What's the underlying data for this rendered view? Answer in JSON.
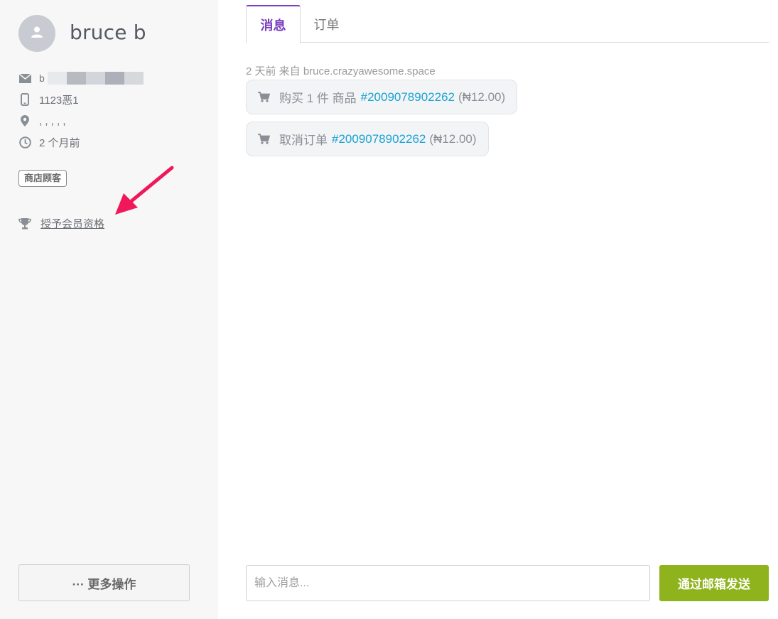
{
  "customer": {
    "name": "bruce b",
    "email_visible": "b",
    "phone": "1123恶1",
    "address": ", , , , ,",
    "since": "2 个月前",
    "badge": "商店顾客",
    "membership_link": "授予会员资格"
  },
  "sidebar": {
    "more_actions_label": "··· 更多操作"
  },
  "tabs": [
    {
      "label": "消息",
      "active": true
    },
    {
      "label": "订单",
      "active": false
    }
  ],
  "messages": {
    "meta": "2 天前 来自 bruce.crazyawesome.space",
    "items": [
      {
        "text": "购买 1 件 商品",
        "order": "#2009078902262",
        "amount": "(₦12.00)"
      },
      {
        "text": "取消订单",
        "order": "#2009078902262",
        "amount": "(₦12.00)"
      }
    ]
  },
  "composer": {
    "placeholder": "输入消息...",
    "send_label": "通过邮箱发送"
  },
  "colors": {
    "accent": "#7b3fbf",
    "link": "#1aa3d4",
    "send_button": "#8fb31d",
    "annotation_arrow": "#f0185a"
  }
}
